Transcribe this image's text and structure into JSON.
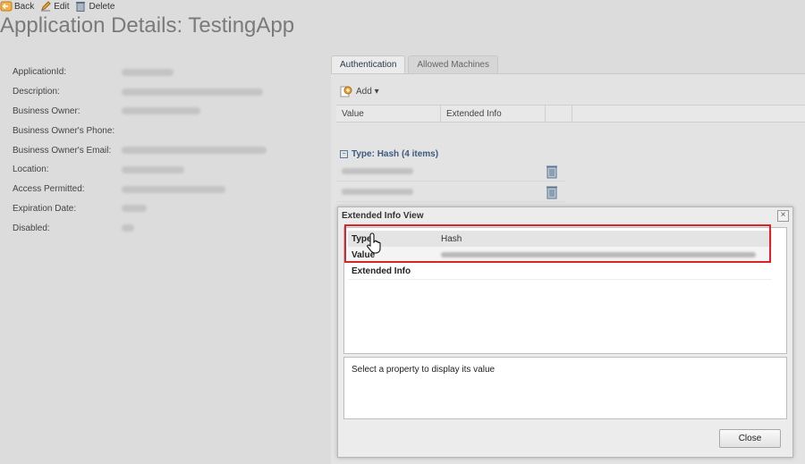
{
  "toolbar": {
    "back_label": "Back",
    "edit_label": "Edit",
    "delete_label": "Delete"
  },
  "page": {
    "title": "Application Details: TestingApp"
  },
  "details": {
    "labels": [
      "ApplicationId:",
      "Description:",
      "Business Owner:",
      "Business Owner's Phone:",
      "Business Owner's Email:",
      "Location:",
      "Access Permitted:",
      "Expiration Date:",
      "Disabled:"
    ]
  },
  "tabs": [
    {
      "label": "Authentication",
      "active": true
    },
    {
      "label": "Allowed Machines",
      "active": false
    }
  ],
  "grid": {
    "add_label": "Add ▾",
    "columns": [
      "Value",
      "Extended Info"
    ],
    "group_label": "Type: Hash (4 items)"
  },
  "modal": {
    "title": "Extended Info View",
    "properties": [
      {
        "key": "Type",
        "value": "Hash"
      },
      {
        "key": "Value",
        "value": ""
      },
      {
        "key": "Extended Info",
        "value": ""
      }
    ],
    "description": "Select a property to display its value",
    "close_label": "Close"
  },
  "colors": {
    "highlight": "#d9252a",
    "group_text": "#3d5a80",
    "title": "#7a7a7a"
  }
}
